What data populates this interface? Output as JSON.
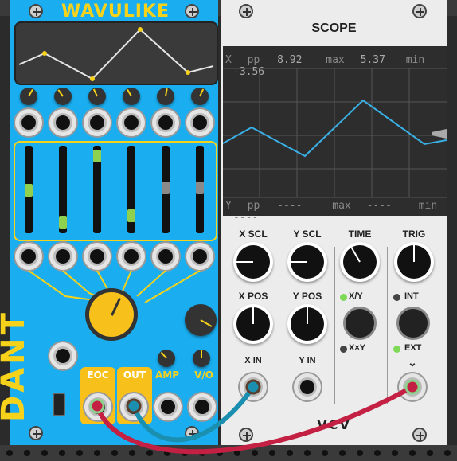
{
  "wavulike": {
    "brand": "DANT",
    "title": "WAVULIKE",
    "jack_labels": [
      "EOC",
      "OUT",
      "AMP",
      "V/O"
    ],
    "colors": {
      "panel": "#1aaef0",
      "accent": "#f7d21b",
      "trace": "#e5e5e5"
    }
  },
  "scope": {
    "title": "SCOPE",
    "x_readout": {
      "channel": "X",
      "pp_label": "pp",
      "pp": "8.92",
      "max_label": "max",
      "max": "5.37",
      "min_label": "min",
      "min": "-3.56"
    },
    "y_readout": {
      "channel": "Y",
      "pp_label": "pp",
      "pp": "----",
      "max_label": "max",
      "max": "----",
      "min_label": "min",
      "min": "----"
    },
    "knob_labels": {
      "x_scl": "X SCL",
      "y_scl": "Y SCL",
      "time": "TIME",
      "trig": "TRIG",
      "x_pos": "X POS",
      "y_pos": "Y POS"
    },
    "mode_labels": {
      "xy": "X/Y",
      "xxy": "X×Y",
      "int": "INT",
      "ext": "EXT",
      "ext_arrow": "⌄"
    },
    "input_labels": {
      "x_in": "X IN",
      "y_in": "Y IN"
    },
    "footer": "VCV",
    "colors": {
      "trace": "#3ab0e6",
      "led_on": "#7ed957",
      "led_off": "#444444"
    }
  },
  "cables": {
    "red": "#c42044",
    "blue": "#1a8fb0"
  }
}
